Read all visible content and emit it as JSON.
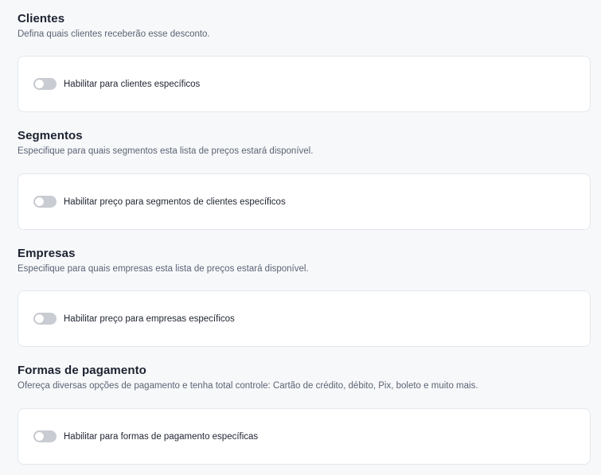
{
  "sections": [
    {
      "title": "Clientes",
      "description": "Defina quais clientes receberão esse desconto.",
      "toggle_label": "Habilitar para clientes específicos",
      "enabled": false
    },
    {
      "title": "Segmentos",
      "description": "Especifique para quais segmentos esta lista de preços estará disponível.",
      "toggle_label": "Habilitar preço para segmentos de clientes específicos",
      "enabled": false
    },
    {
      "title": "Empresas",
      "description": "Especifique para quais empresas esta lista de preços estará disponível.",
      "toggle_label": "Habilitar preço para empresas específicos",
      "enabled": false
    },
    {
      "title": "Formas de pagamento",
      "description": "Ofereça diversas opções de pagamento e tenha total controle: Cartão de crédito, débito, Pix, boleto e muito mais.",
      "toggle_label": "Habilitar para formas de pagamento específicas",
      "enabled": false
    }
  ],
  "colors": {
    "toggle_off": "#c9ccd2",
    "card_border": "#e4e7ec",
    "background": "#f7f8fa"
  }
}
